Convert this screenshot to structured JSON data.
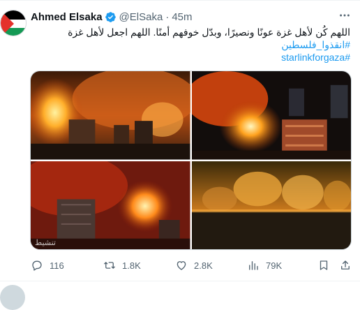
{
  "tweet": {
    "author": {
      "display_name": "Ahmed Elsaka",
      "handle": "@ElSaka",
      "verified_icon": "verified-badge-icon",
      "avatar": "palestine-flag-avatar"
    },
    "separator": "·",
    "time": "45m",
    "text_line1": "اللهم كُن لأهل غزة عونًا ونصيرًا، وبدّل خوفهم أمنًا. اللهم اجعل لأهل غزة",
    "hashtag1": "#انقذوا_فلسطين",
    "hashtag2": "#starlinkforgaza",
    "media": {
      "images": [
        "night-explosion-city",
        "fireball-over-buildings",
        "explosion-smoke-tower",
        "skyline-fires-night"
      ],
      "watermark": "تنشيط"
    },
    "actions": {
      "replies": "116",
      "reposts": "1.8K",
      "likes": "2.8K",
      "views": "79K"
    }
  },
  "colors": {
    "link": "#1d9bf0",
    "secondary_text": "#536471",
    "verified": "#1d9bf0"
  }
}
